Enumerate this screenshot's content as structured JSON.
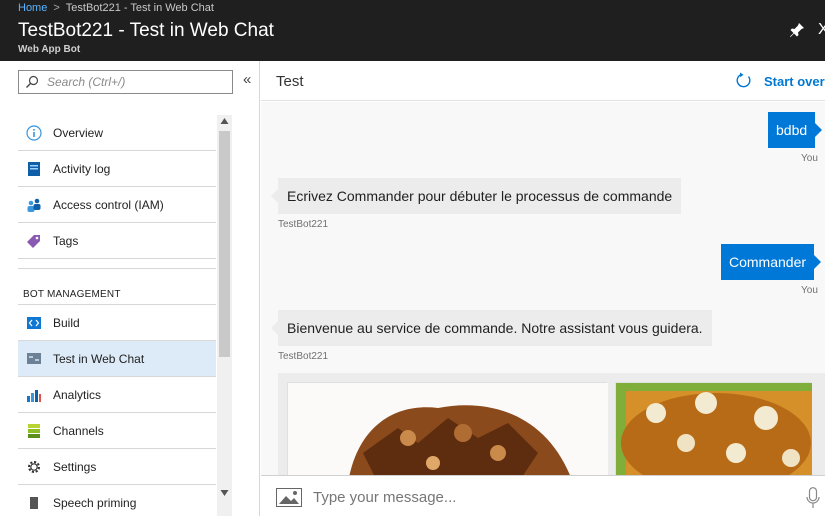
{
  "header": {
    "breadcrumb": [
      {
        "label": "Home"
      },
      {
        "label": "TestBot221 - Test in Web Chat"
      }
    ],
    "breadcrumb_sep": ">",
    "title": "TestBot221 - Test in Web Chat",
    "subtitle": "Web App Bot",
    "close_glyph": "X"
  },
  "sidebar": {
    "search_placeholder": "Search (Ctrl+/)",
    "collapse_glyph": "«",
    "items": [
      {
        "label": "Overview",
        "icon": "info-circle-icon",
        "active": false
      },
      {
        "label": "Activity log",
        "icon": "activity-log-icon",
        "active": false
      },
      {
        "label": "Access control (IAM)",
        "icon": "people-icon",
        "active": false
      },
      {
        "label": "Tags",
        "icon": "tag-icon",
        "active": false
      }
    ],
    "section_title": "BOT MANAGEMENT",
    "bot_items": [
      {
        "label": "Build",
        "icon": "code-icon",
        "active": false
      },
      {
        "label": "Test in Web Chat",
        "icon": "chat-icon",
        "active": true
      },
      {
        "label": "Analytics",
        "icon": "analytics-icon",
        "active": false
      },
      {
        "label": "Channels",
        "icon": "channels-icon",
        "active": false
      },
      {
        "label": "Settings",
        "icon": "gear-icon",
        "active": false
      },
      {
        "label": "Speech priming",
        "icon": "speech-icon",
        "active": false
      }
    ]
  },
  "chat": {
    "title": "Test",
    "start_over": "Start over",
    "messages": [
      {
        "from": "user",
        "text": "bdbd",
        "caption": "You"
      },
      {
        "from": "bot",
        "text": "Ecrivez Commander pour débuter le processus de commande",
        "caption": "TestBot221"
      },
      {
        "from": "user",
        "text": "Commander",
        "caption": "You"
      },
      {
        "from": "bot",
        "text": "Bienvenue au service de commande. Notre assistant vous guidera.",
        "caption": "TestBot221"
      }
    ],
    "input_placeholder": "Type your message..."
  },
  "colors": {
    "accent": "#0078d7",
    "header_bg": "#1f1f1f",
    "active_nav": "#ddeaf7"
  }
}
